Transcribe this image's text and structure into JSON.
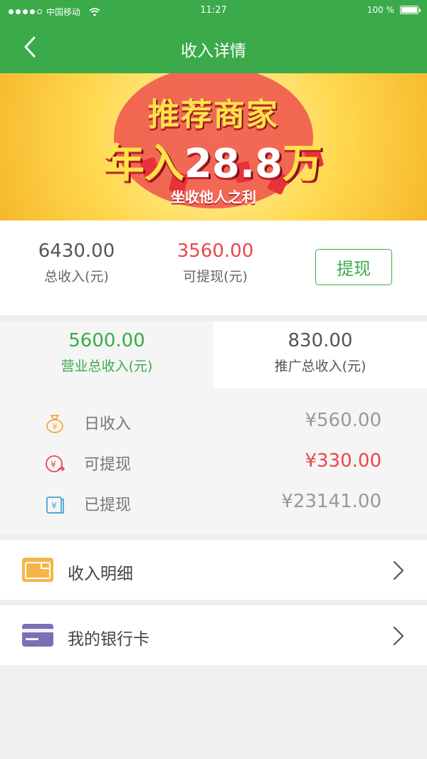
{
  "status_bar": {
    "carrier": "中国移动",
    "time": "11:27",
    "battery": "100 %"
  },
  "nav": {
    "title": "收入详情"
  },
  "banner": {
    "line1": "推荐商家",
    "line2_prefix": "年入",
    "line2_number": "28.8",
    "line2_suffix": "万",
    "line3": "坐收他人之利"
  },
  "summary": {
    "total_income": {
      "value": "6430.00",
      "label": "总收入(元)"
    },
    "withdrawable": {
      "value": "3560.00",
      "label": "可提现(元)"
    },
    "withdraw_button": "提现"
  },
  "tabs": [
    {
      "value": "5600.00",
      "label": "营业总收入(元)"
    },
    {
      "value": "830.00",
      "label": "推广总收入(元)"
    }
  ],
  "details": [
    {
      "icon": "money-bag-icon",
      "label": "日收入",
      "value": "¥560.00",
      "color": "#999999"
    },
    {
      "icon": "withdraw-icon",
      "label": "可提现",
      "value": "¥330.00",
      "color": "#e8474d"
    },
    {
      "icon": "withdrawn-icon",
      "label": "已提现",
      "value": "¥23141.00",
      "color": "#999999"
    }
  ],
  "menu": [
    {
      "icon": "wallet-icon",
      "label": "收入明细"
    },
    {
      "icon": "bank-card-icon",
      "label": "我的银行卡"
    }
  ],
  "colors": {
    "primary": "#3aaa4a",
    "accent_red": "#e8474d"
  }
}
